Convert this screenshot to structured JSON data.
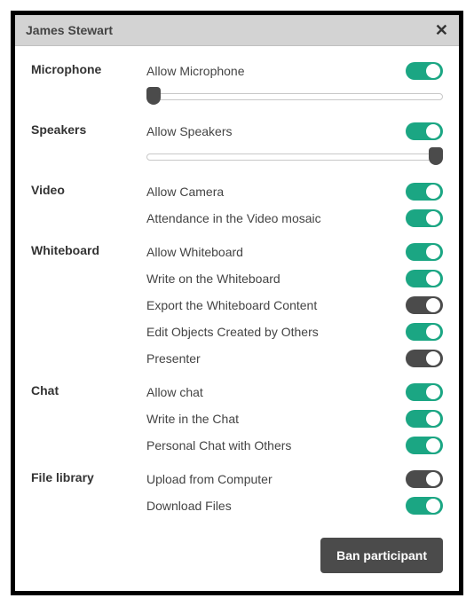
{
  "titlebar": {
    "title": "James Stewart"
  },
  "sections": {
    "microphone": {
      "heading": "Microphone",
      "allow_label": "Allow Microphone",
      "allow_on": true,
      "slider_percent": 0
    },
    "speakers": {
      "heading": "Speakers",
      "allow_label": "Allow Speakers",
      "allow_on": true,
      "slider_percent": 100
    },
    "video": {
      "heading": "Video",
      "items": [
        {
          "label": "Allow Camera",
          "on": true
        },
        {
          "label": "Attendance in the Video mosaic",
          "on": true
        }
      ]
    },
    "whiteboard": {
      "heading": "Whiteboard",
      "items": [
        {
          "label": "Allow Whiteboard",
          "on": true
        },
        {
          "label": "Write on the Whiteboard",
          "on": true
        },
        {
          "label": "Export the Whiteboard Content",
          "on": false
        },
        {
          "label": "Edit Objects Created by Others",
          "on": true
        },
        {
          "label": "Presenter",
          "on": false
        }
      ]
    },
    "chat": {
      "heading": "Chat",
      "items": [
        {
          "label": "Allow chat",
          "on": true
        },
        {
          "label": "Write in the Chat",
          "on": true
        },
        {
          "label": "Personal Chat with Others",
          "on": true
        }
      ]
    },
    "file_library": {
      "heading": "File library",
      "items": [
        {
          "label": "Upload from Computer",
          "on": false
        },
        {
          "label": "Download Files",
          "on": true
        }
      ]
    }
  },
  "footer": {
    "ban_label": "Ban participant"
  },
  "colors": {
    "accent_on": "#1ba683",
    "accent_off": "#4b4b4b"
  }
}
